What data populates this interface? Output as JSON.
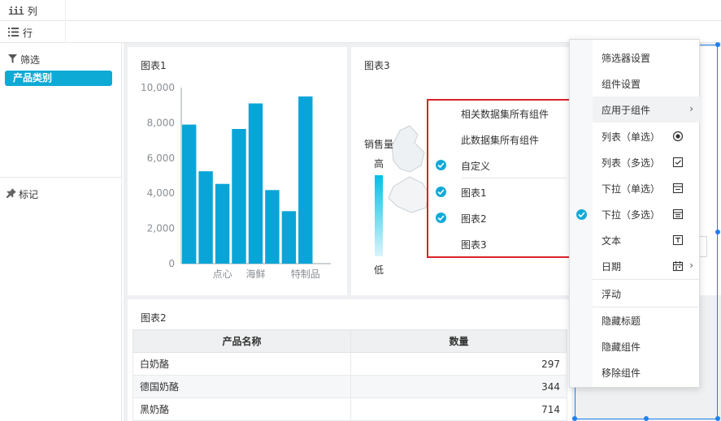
{
  "shelves": {
    "columns_label": "列",
    "rows_label": "行"
  },
  "left": {
    "filter_title": "筛选",
    "filter_chip": "产品类别",
    "mark_title": "标记"
  },
  "chart1": {
    "title": "图表1",
    "y_ticks": [
      "10,000",
      "8,000",
      "6,000",
      "4,000",
      "2,000",
      "0"
    ],
    "x_labels": [
      "点心",
      "海鲜",
      "特制品"
    ],
    "color": "#0aa5d8"
  },
  "chart3": {
    "title": "图表3",
    "legend_title": "销售量",
    "legend_high": "高",
    "legend_low": "低"
  },
  "chart2": {
    "title": "图表2",
    "headers": [
      "产品名称",
      "数量"
    ],
    "rows": [
      {
        "name": "白奶酪",
        "qty": "297"
      },
      {
        "name": "德国奶酪",
        "qty": "344"
      },
      {
        "name": "黑奶酪",
        "qty": "714"
      }
    ]
  },
  "submenu": {
    "items": [
      {
        "label": "相关数据集所有组件",
        "checked": false
      },
      {
        "label": "此数据集所有组件",
        "checked": false
      },
      {
        "label": "自定义",
        "checked": true
      },
      {
        "label": "图表1",
        "checked": true
      },
      {
        "label": "图表2",
        "checked": true
      },
      {
        "label": "图表3",
        "checked": false
      }
    ]
  },
  "contextmenu": {
    "items": [
      {
        "label": "筛选器设置"
      },
      {
        "label": "组件设置"
      },
      {
        "label": "应用于组件"
      },
      {
        "label": "列表（单选）"
      },
      {
        "label": "列表（多选）"
      },
      {
        "label": "下拉（单选）"
      },
      {
        "label": "下拉（多选）"
      },
      {
        "label": "文本"
      },
      {
        "label": "日期"
      },
      {
        "label": "浮动"
      },
      {
        "label": "隐藏标题"
      },
      {
        "label": "隐藏组件"
      },
      {
        "label": "移除组件"
      }
    ]
  },
  "chart_data": {
    "type": "bar",
    "categories": [
      "",
      "",
      "点心",
      "",
      "海鲜",
      "",
      "",
      "特制品",
      ""
    ],
    "values": [
      7900,
      5250,
      4530,
      7650,
      9100,
      4180,
      2980,
      9500,
      0
    ],
    "ylim": [
      0,
      10000
    ],
    "grid": false
  },
  "accent": "#0eaad6",
  "highlight_border": "#d9222a",
  "selection_color": "#1e7ff0"
}
